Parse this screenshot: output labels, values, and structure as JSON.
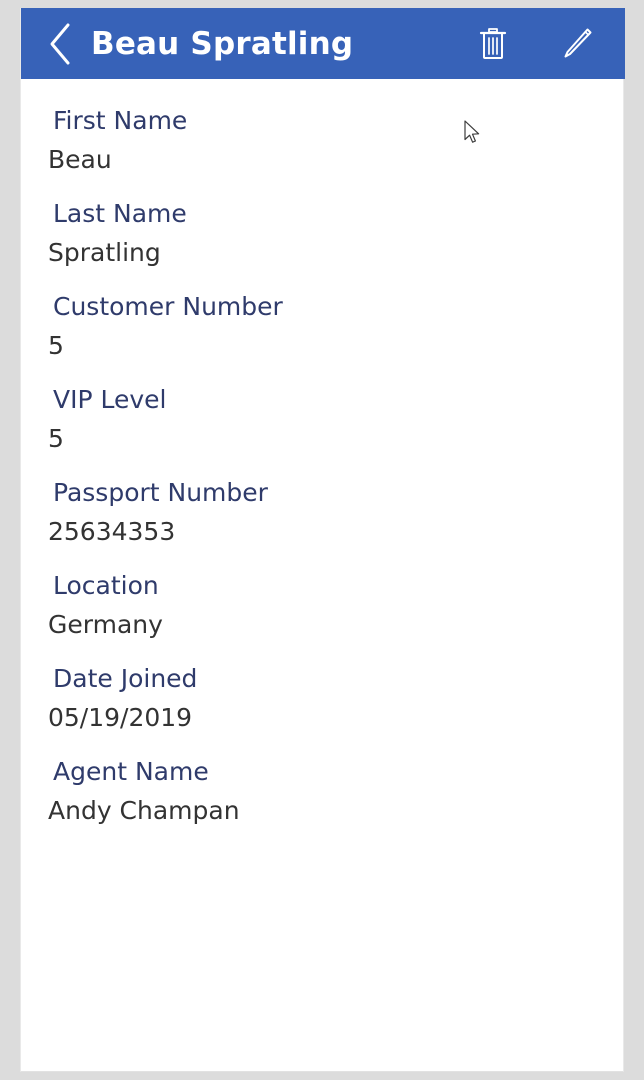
{
  "appbar": {
    "title": "Beau Spratling",
    "back_icon": "chevron-left-icon",
    "delete_icon": "trash-icon",
    "edit_icon": "pencil-icon"
  },
  "detail": {
    "fields": [
      {
        "label": "First Name",
        "value": "Beau"
      },
      {
        "label": "Last Name",
        "value": "Spratling"
      },
      {
        "label": "Customer Number",
        "value": "5"
      },
      {
        "label": "VIP Level",
        "value": "5"
      },
      {
        "label": "Passport Number",
        "value": "25634353"
      },
      {
        "label": "Location",
        "value": "Germany"
      },
      {
        "label": "Date Joined",
        "value": "05/19/2019"
      },
      {
        "label": "Agent Name",
        "value": "Andy Champan"
      }
    ]
  },
  "colors": {
    "appbar_background": "#3762b8",
    "appbar_text": "#ffffff",
    "label_text": "#2f3b6b",
    "value_text": "#333333",
    "page_background": "#dcdcdc",
    "panel_background": "#ffffff"
  }
}
